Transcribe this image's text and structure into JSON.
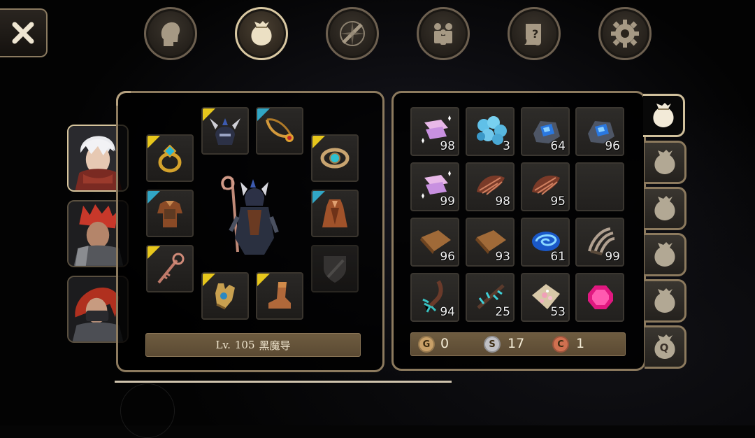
{
  "top_nav": {
    "close_icon": "close-x-icon",
    "tabs": [
      {
        "name": "character",
        "icon": "head-silhouette-icon",
        "active": false
      },
      {
        "name": "inventory",
        "icon": "bag-icon",
        "active": true
      },
      {
        "name": "skills",
        "icon": "sword-compass-icon",
        "active": false
      },
      {
        "name": "party",
        "icon": "people-icon",
        "active": false
      },
      {
        "name": "quests",
        "icon": "scroll-icon",
        "active": false
      },
      {
        "name": "settings",
        "icon": "gear-icon",
        "active": false
      }
    ]
  },
  "portraits": [
    {
      "name": "white-haired-hero",
      "active": true
    },
    {
      "name": "red-haired-warrior",
      "active": false
    },
    {
      "name": "masked-red-hair",
      "active": false
    }
  ],
  "equipment": {
    "level_prefix": "Lv.",
    "level": "105",
    "class_name": "黑魔导",
    "slots": [
      {
        "name": "helmet",
        "icon": "horned-helmet-icon",
        "tier": "yellow"
      },
      {
        "name": "necklace",
        "icon": "necklace-icon",
        "tier": "cyan"
      },
      {
        "name": "ring-left",
        "icon": "gold-ring-icon",
        "tier": "yellow"
      },
      {
        "name": "ring-right",
        "icon": "silver-ring-icon",
        "tier": "yellow"
      },
      {
        "name": "armor",
        "icon": "armor-icon",
        "tier": "cyan"
      },
      {
        "name": "cloak",
        "icon": "cloak-icon",
        "tier": "cyan"
      },
      {
        "name": "weapon",
        "icon": "staff-icon",
        "tier": "yellow"
      },
      {
        "name": "offhand",
        "icon": "shield-sword-icon",
        "tier": "none"
      },
      {
        "name": "gloves",
        "icon": "gauntlet-icon",
        "tier": "yellow"
      },
      {
        "name": "boots",
        "icon": "boot-icon",
        "tier": "yellow"
      }
    ]
  },
  "inventory": {
    "items": [
      {
        "icon": "pink-crystal-icon",
        "qty": "98"
      },
      {
        "icon": "blue-orbs-icon",
        "qty": "3"
      },
      {
        "icon": "blue-gem-ore-icon",
        "qty": "64"
      },
      {
        "icon": "blue-gem-ore-icon",
        "qty": "96"
      },
      {
        "icon": "pink-crystal-icon",
        "qty": "99"
      },
      {
        "icon": "red-feather-icon",
        "qty": "98"
      },
      {
        "icon": "red-feather-icon",
        "qty": "95"
      },
      {
        "icon": "empty",
        "qty": ""
      },
      {
        "icon": "leather-hide-icon",
        "qty": "96"
      },
      {
        "icon": "leather-hide-icon",
        "qty": "93"
      },
      {
        "icon": "blue-swirl-icon",
        "qty": "61"
      },
      {
        "icon": "claw-icon",
        "qty": "99"
      },
      {
        "icon": "teal-root-icon",
        "qty": "94"
      },
      {
        "icon": "teal-branch-icon",
        "qty": "25"
      },
      {
        "icon": "sparkle-powder-icon",
        "qty": "53"
      },
      {
        "icon": "pink-gem-icon",
        "qty": ""
      }
    ],
    "currency": {
      "gold_letter": "G",
      "gold": "0",
      "silver_letter": "S",
      "silver": "17",
      "copper_letter": "C",
      "copper": "1"
    },
    "bag_tabs": [
      {
        "icon": "bag-icon",
        "active": true
      },
      {
        "icon": "bag-icon",
        "active": false
      },
      {
        "icon": "bag-icon",
        "active": false
      },
      {
        "icon": "bag-icon",
        "active": false
      },
      {
        "icon": "bag-icon",
        "active": false
      },
      {
        "icon": "quest-bag-icon",
        "label": "Q",
        "active": false
      }
    ]
  },
  "colors": {
    "tier_yellow": "#e7c71c",
    "tier_cyan": "#31a6c5",
    "frame": "#8c7a5e",
    "bar": "#6e5c40"
  }
}
